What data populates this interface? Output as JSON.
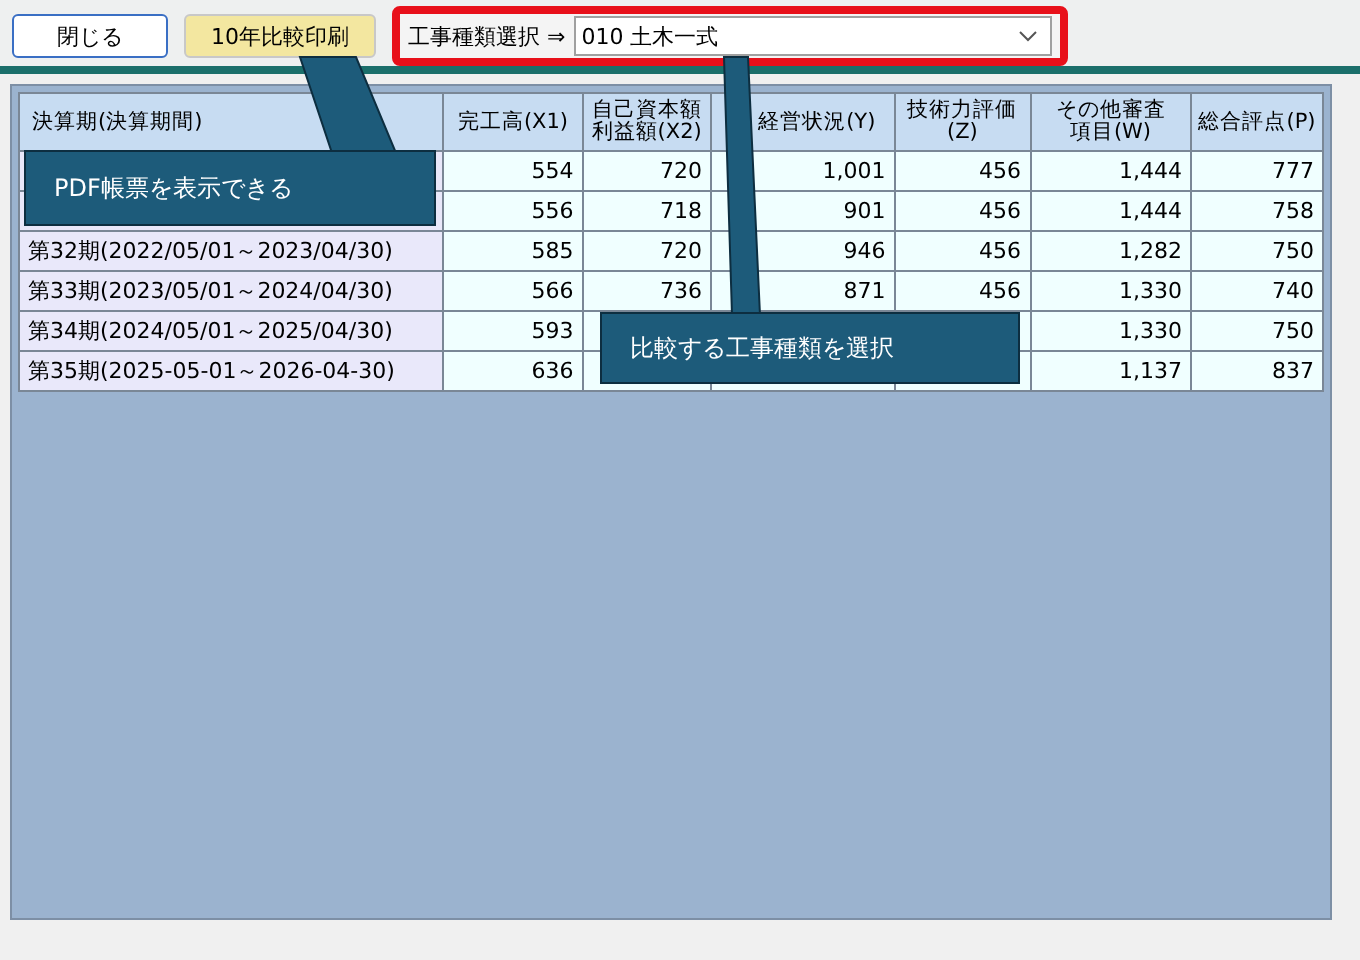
{
  "toolbar": {
    "close_button": "閉じる",
    "print_button": "10年比較印刷",
    "type_label": "工事種類選択 ⇒",
    "type_select": "010 土木一式"
  },
  "table": {
    "columns": [
      "決算期(決算期間)",
      "完工高(X1)",
      "自己資本額利益額(X2)",
      "経営状況(Y)",
      "技術力評価(Z)",
      "その他審査項目(W)",
      "総合評点(P)"
    ],
    "rows": [
      {
        "cells": [
          "",
          "554",
          "720",
          "1,001",
          "456",
          "1,444",
          "777"
        ]
      },
      {
        "cells": [
          "",
          "556",
          "718",
          "901",
          "456",
          "1,444",
          "758"
        ]
      },
      {
        "cells": [
          "第32期(2022/05/01～2023/04/30)",
          "585",
          "720",
          "946",
          "456",
          "1,282",
          "750"
        ]
      },
      {
        "cells": [
          "第33期(2023/05/01～2024/04/30)",
          "566",
          "736",
          "871",
          "456",
          "1,330",
          "740"
        ]
      },
      {
        "cells": [
          "第34期(2024/05/01～2025/04/30)",
          "593",
          "",
          "",
          "",
          "1,330",
          "750"
        ]
      },
      {
        "cells": [
          "第35期(2025-05-01～2026-04-30)",
          "636",
          "",
          "",
          "",
          "1,137",
          "837"
        ]
      }
    ]
  },
  "callouts": [
    {
      "text": "PDF帳票を表示できる"
    },
    {
      "text": "比較する工事種類を選択"
    }
  ]
}
